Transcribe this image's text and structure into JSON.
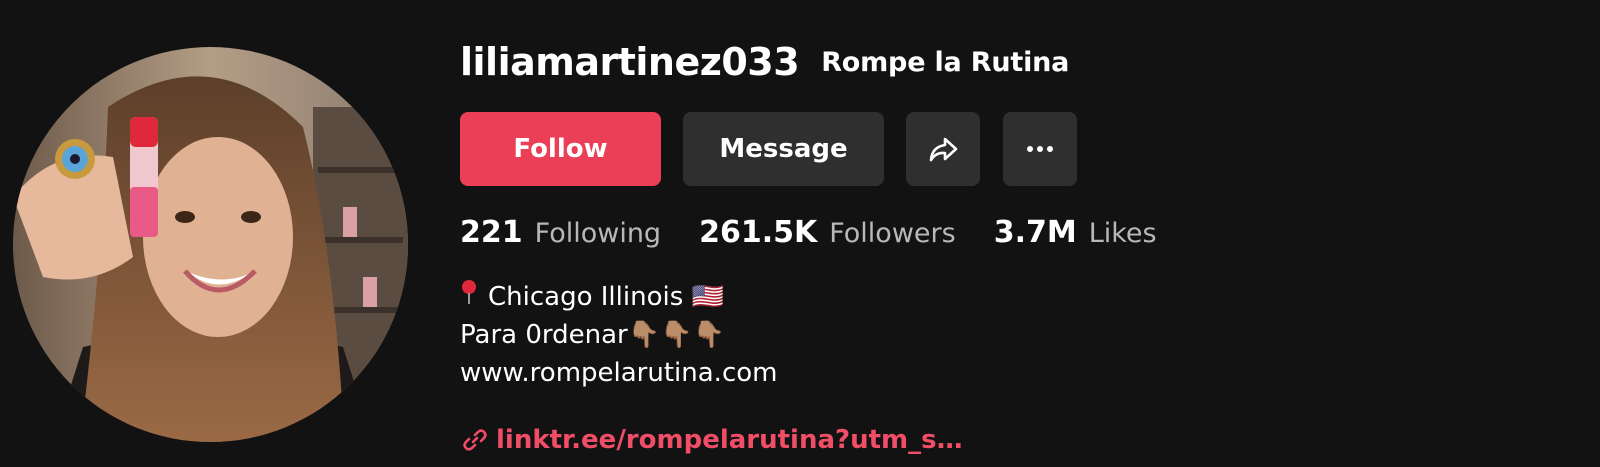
{
  "profile": {
    "username": "liliamartinez033",
    "nickname": "Rompe la Rutina",
    "avatar_icon": "profile-photo"
  },
  "actions": {
    "follow_label": "Follow",
    "message_label": "Message",
    "share_icon": "share-arrow-icon",
    "more_icon": "more-dots-icon"
  },
  "stats": {
    "following_count": "221",
    "following_label": "Following",
    "followers_count": "261.5K",
    "followers_label": "Followers",
    "likes_count": "3.7M",
    "likes_label": "Likes"
  },
  "bio": {
    "line1": "Chicago Illinois 🇺🇸",
    "line2": "Para 0rdenar👇🏽👇🏽👇🏽",
    "line3": "www.rompelarutina.com"
  },
  "link": {
    "icon": "link-icon",
    "text": "linktr.ee/rompelarutina?utm_s…"
  },
  "colors": {
    "background": "#121212",
    "follow_button": "#ea3f56",
    "secondary_button": "#2f2f2f",
    "link": "#f24d66",
    "muted_text": "#b8b8b8"
  }
}
